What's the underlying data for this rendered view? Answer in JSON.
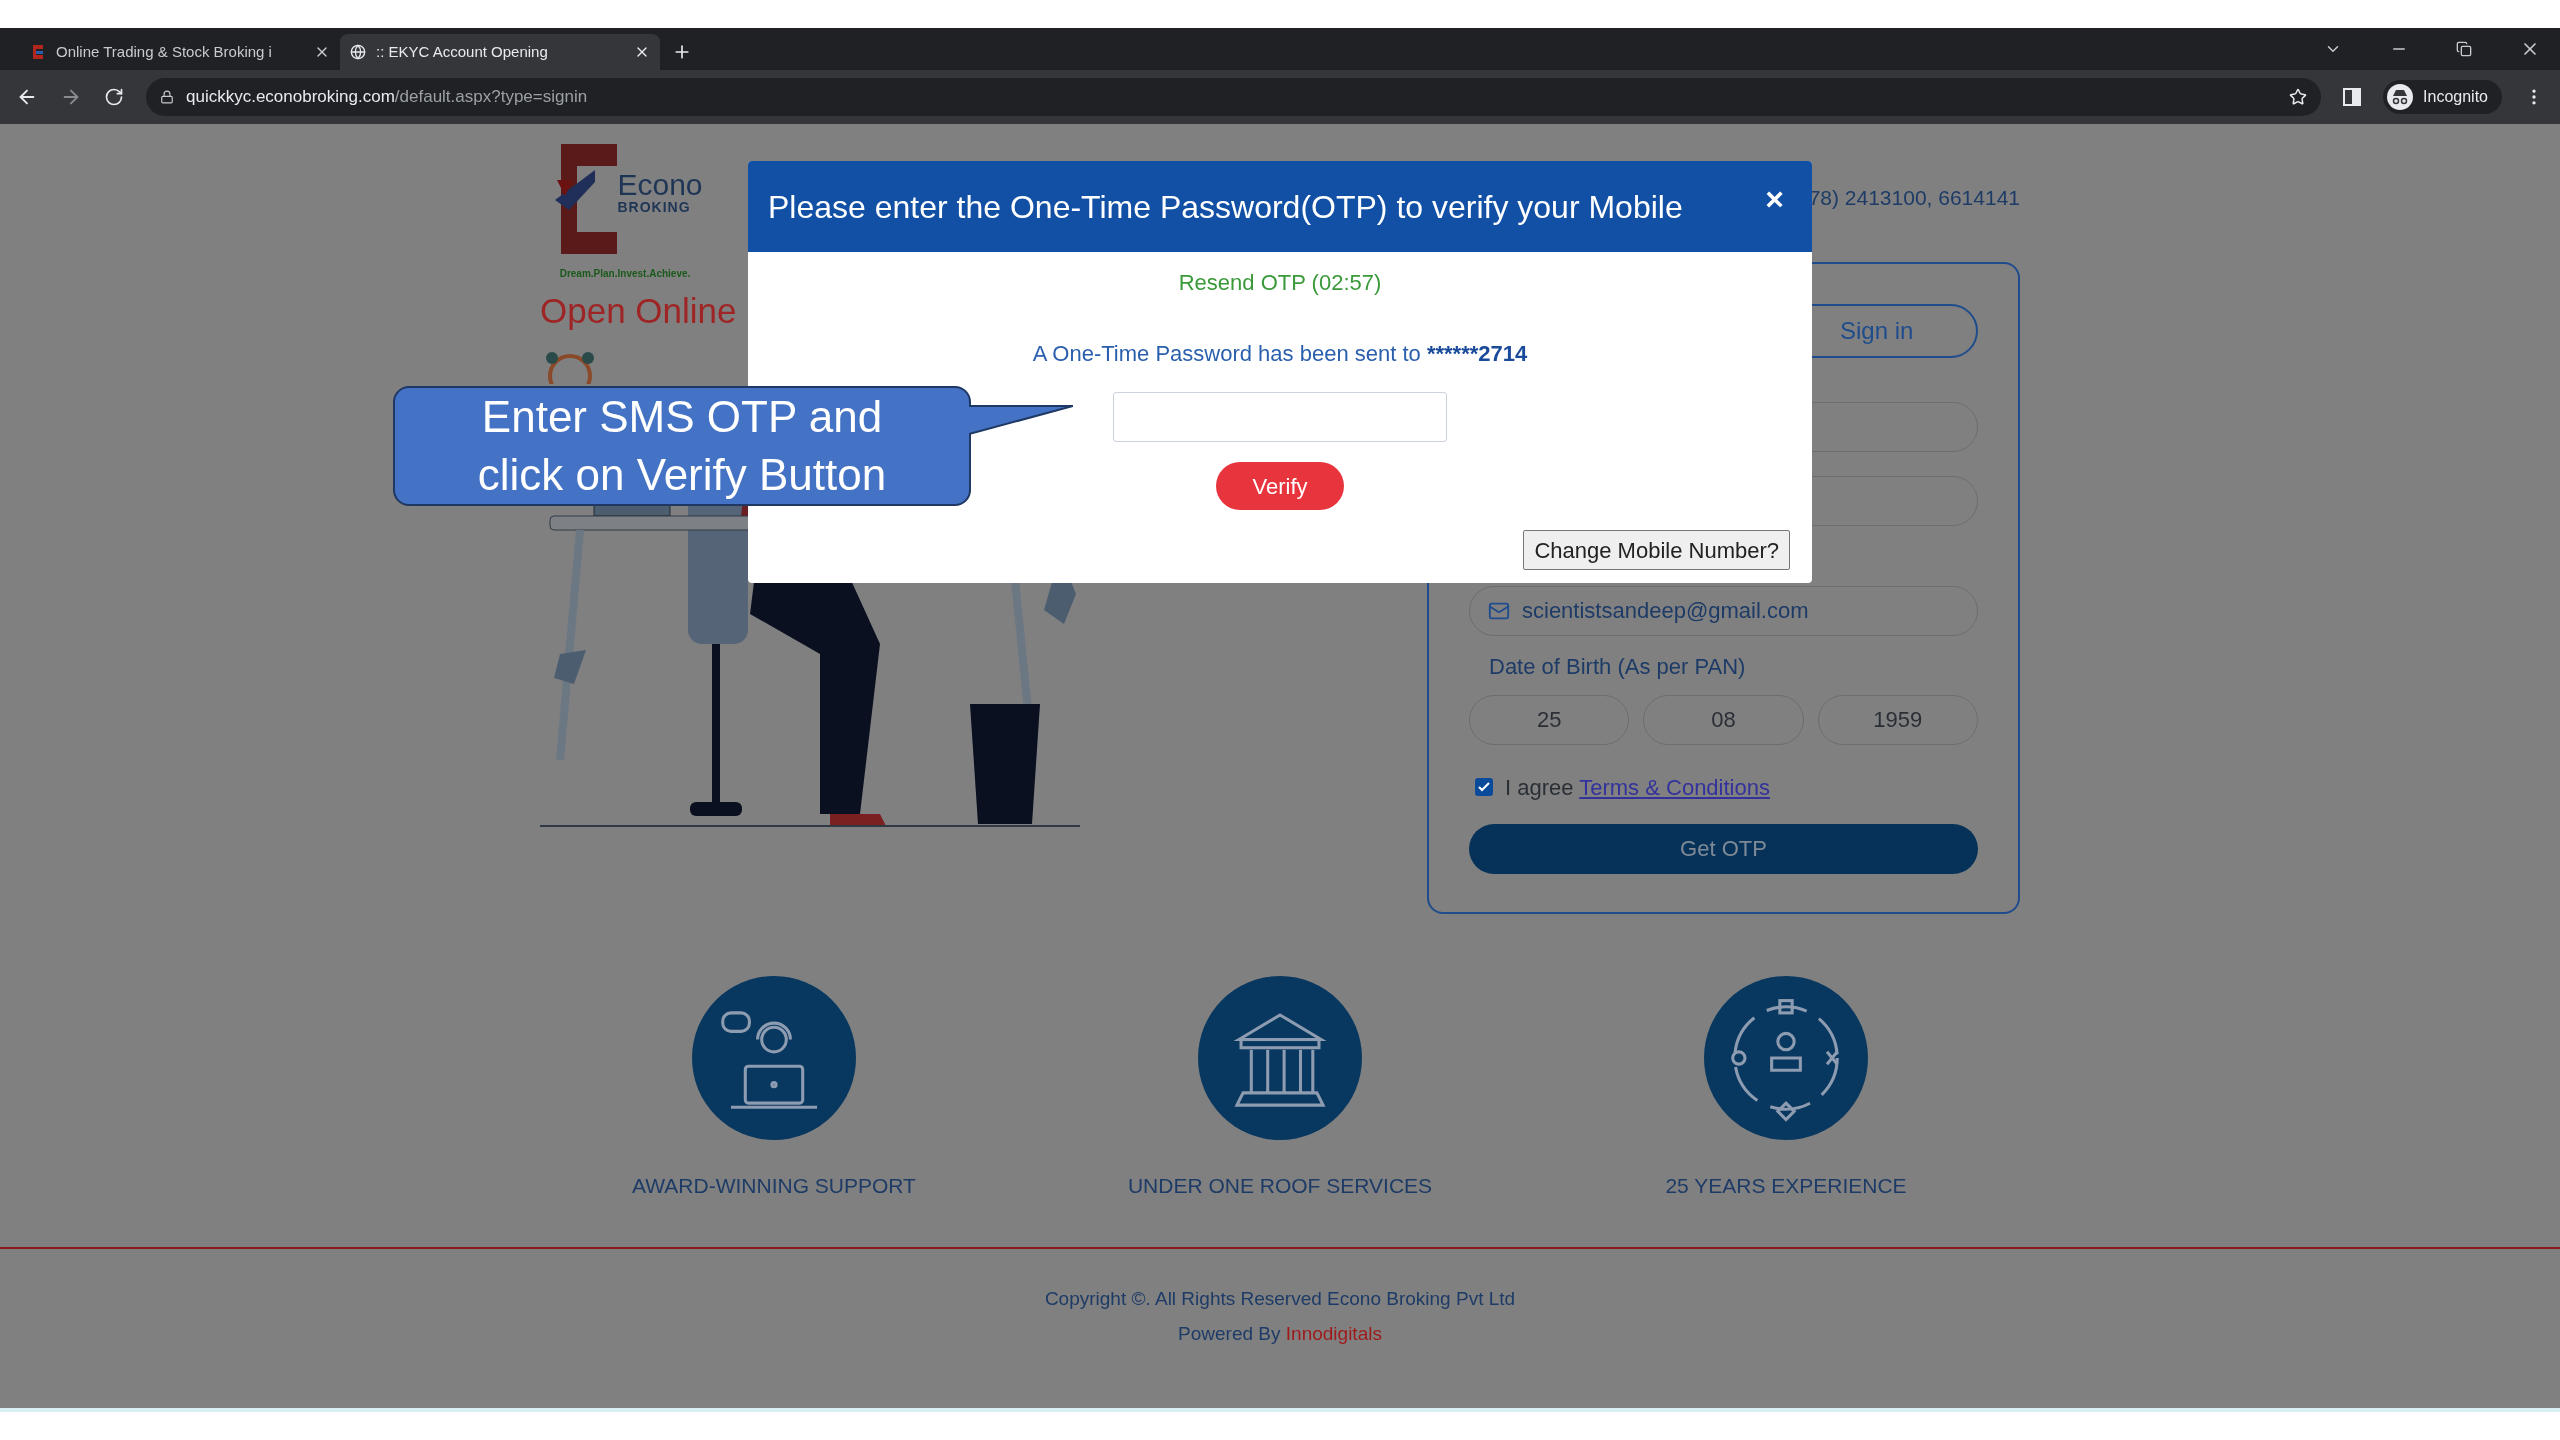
{
  "browser": {
    "tabs": [
      {
        "title": "Online Trading & Stock Broking i",
        "selected": false
      },
      {
        "title": ":: EKYC Account Opening",
        "selected": true
      }
    ],
    "url_host": "quickkyc.econobroking.com",
    "url_path": "/default.aspx?type=signin",
    "profile_label": "Incognito"
  },
  "page": {
    "logo": {
      "name": "Econo",
      "sub": "BROKING",
      "tagline": "Dream.Plan.Invest.Achieve."
    },
    "heading": "Open Online",
    "phone": "78) 2413100, 6614141",
    "signin_card": {
      "signin_button": "Sign in",
      "email": "scientistsandeep@gmail.com",
      "dob_label": "Date of Birth (As per PAN)",
      "dob": [
        "25",
        "08",
        "1959"
      ],
      "agree": {
        "checked": true,
        "text": "I agree",
        "link": "Terms & Conditions"
      },
      "submit": "Get OTP"
    },
    "features": [
      {
        "kind": "support",
        "label": "AWARD-WINNING SUPPORT"
      },
      {
        "kind": "bank",
        "label": "UNDER ONE ROOF SERVICES"
      },
      {
        "kind": "network",
        "label": "25 YEARS EXPERIENCE"
      }
    ],
    "footer": {
      "copyright": "Copyright ©. All Rights Reserved Econo Broking Pvt Ltd",
      "powered_by": "Powered By",
      "powered_link": "Innodigitals"
    }
  },
  "modal": {
    "title": "Please enter the One-Time Password(OTP) to verify your Mobile",
    "close": "×",
    "resend": "Resend OTP (02:57)",
    "sent_text": "A One-Time Password has been sent to",
    "sent_number": "******2714",
    "verify": "Verify",
    "change_number": "Change Mobile Number?"
  },
  "callout": {
    "lines": [
      "Enter SMS OTP and",
      "click on Verify Button"
    ]
  }
}
